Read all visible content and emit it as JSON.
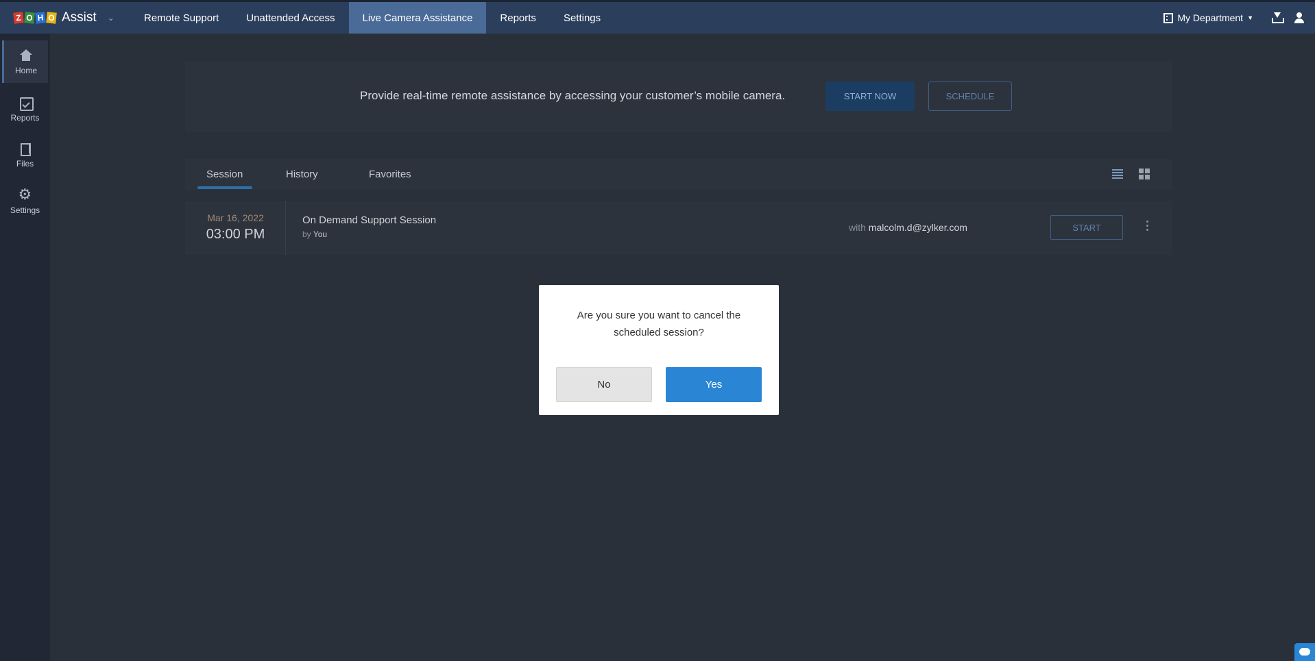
{
  "app": {
    "brand_letters": [
      "Z",
      "O",
      "H",
      "O"
    ],
    "name": "Assist"
  },
  "nav": {
    "items": [
      {
        "label": "Remote Support"
      },
      {
        "label": "Unattended Access"
      },
      {
        "label": "Live Camera Assistance",
        "active": true
      },
      {
        "label": "Reports"
      },
      {
        "label": "Settings"
      }
    ]
  },
  "top_right": {
    "department": "My Department",
    "icons": [
      "building-icon",
      "download-icon",
      "user-icon"
    ]
  },
  "sidebar": {
    "items": [
      {
        "label": "Home",
        "icon": "home-icon",
        "active": true
      },
      {
        "label": "Reports",
        "icon": "reports-icon"
      },
      {
        "label": "Files",
        "icon": "files-icon"
      },
      {
        "label": "Settings",
        "icon": "gear-icon"
      }
    ]
  },
  "banner": {
    "text": "Provide real-time remote assistance by accessing your customer’s mobile camera.",
    "start_now": "START NOW",
    "schedule": "SCHEDULE"
  },
  "tabs": {
    "items": [
      {
        "label": "Session",
        "active": true
      },
      {
        "label": "History"
      },
      {
        "label": "Favorites"
      }
    ]
  },
  "session": {
    "date": "Mar 16, 2022",
    "time": "03:00 PM",
    "title": "On Demand Support Session",
    "by_prefix": "by",
    "by": "You",
    "with_prefix": "with",
    "with": "malcolm.d@zylker.com",
    "start_label": "START"
  },
  "modal": {
    "message": "Are you sure you want to cancel the scheduled session?",
    "no_label": "No",
    "yes_label": "Yes"
  },
  "colors": {
    "accent": "#2a86d4",
    "topbar": "#2b3f5c",
    "active_nav": "#4a6b98"
  }
}
